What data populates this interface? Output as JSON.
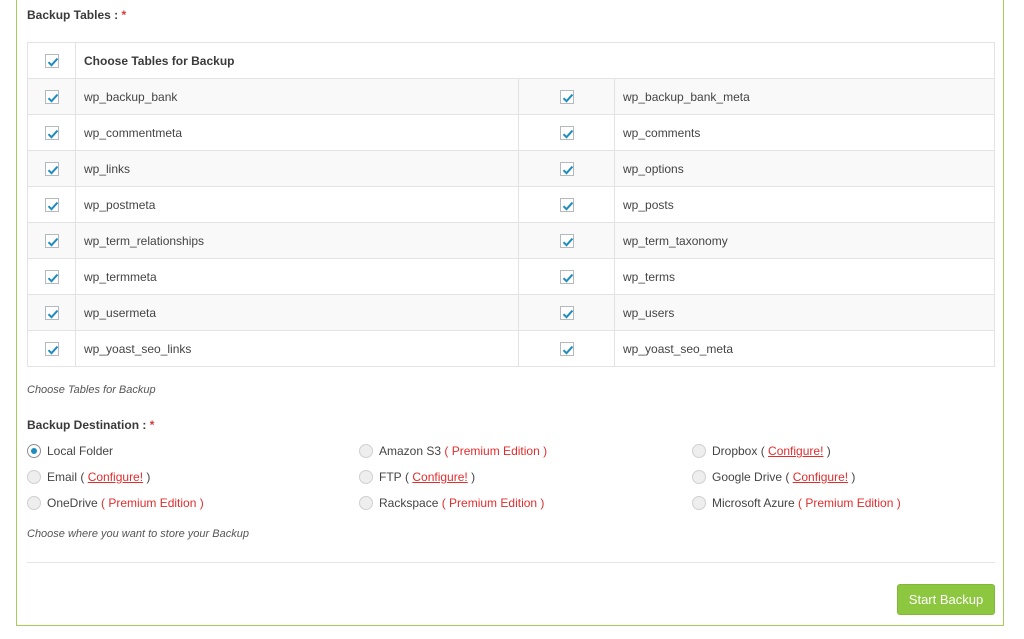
{
  "backup_tables": {
    "label": "Backup Tables :",
    "required_mark": "*",
    "header_label": "Choose Tables for Backup",
    "rows": [
      [
        "wp_backup_bank",
        "wp_backup_bank_meta"
      ],
      [
        "wp_commentmeta",
        "wp_comments"
      ],
      [
        "wp_links",
        "wp_options"
      ],
      [
        "wp_postmeta",
        "wp_posts"
      ],
      [
        "wp_term_relationships",
        "wp_term_taxonomy"
      ],
      [
        "wp_termmeta",
        "wp_terms"
      ],
      [
        "wp_usermeta",
        "wp_users"
      ],
      [
        "wp_yoast_seo_links",
        "wp_yoast_seo_meta"
      ]
    ],
    "hint": "Choose Tables for Backup"
  },
  "backup_destination": {
    "label": "Backup Destination :",
    "required_mark": "*",
    "options": [
      [
        {
          "name": "Local Folder",
          "note": "",
          "link": "",
          "checked": true
        },
        {
          "name": "Amazon S3",
          "note": "( Premium Edition )",
          "link": "",
          "checked": false
        },
        {
          "name": "Dropbox",
          "note": "",
          "link": "Configure!",
          "checked": false
        }
      ],
      [
        {
          "name": "Email",
          "note": "",
          "link": "Configure!",
          "checked": false
        },
        {
          "name": "FTP",
          "note": "",
          "link": "Configure!",
          "checked": false
        },
        {
          "name": "Google Drive",
          "note": "",
          "link": "Configure!",
          "checked": false
        }
      ],
      [
        {
          "name": "OneDrive",
          "note": "( Premium Edition )",
          "link": "",
          "checked": false
        },
        {
          "name": "Rackspace",
          "note": "( Premium Edition )",
          "link": "",
          "checked": false
        },
        {
          "name": "Microsoft Azure",
          "note": "( Premium Edition )",
          "link": "",
          "checked": false
        }
      ]
    ],
    "hint": "Choose where you want to store your Backup"
  },
  "actions": {
    "start_backup": "Start Backup"
  },
  "colors": {
    "accent": "#8dc63f",
    "premium": "#e12d2d",
    "check": "#1e8cbe",
    "frame": "#a8cc58"
  }
}
